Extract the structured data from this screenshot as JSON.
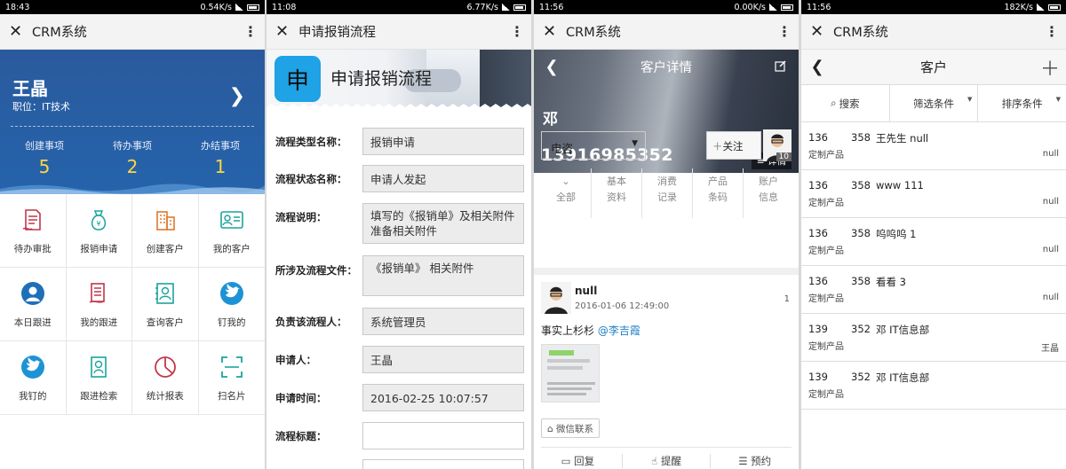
{
  "screens": [
    {
      "status": {
        "time": "18:43",
        "speed": "0.54K/s"
      },
      "title": "CRM系统",
      "user": {
        "name": "王晶",
        "position": "职位：IT技术"
      },
      "stats": [
        {
          "label": "创建事项",
          "value": "5"
        },
        {
          "label": "待办事项",
          "value": "2"
        },
        {
          "label": "办结事项",
          "value": "1"
        }
      ],
      "menu": [
        {
          "label": "待办审批",
          "icon": "document-approval-icon"
        },
        {
          "label": "报销申请",
          "icon": "money-bag-icon"
        },
        {
          "label": "创建客户",
          "icon": "building-icon"
        },
        {
          "label": "我的客户",
          "icon": "id-card-icon"
        },
        {
          "label": "本日跟进",
          "icon": "user-circle-icon"
        },
        {
          "label": "我的跟进",
          "icon": "document-list-icon"
        },
        {
          "label": "查询客户",
          "icon": "contact-card-icon"
        },
        {
          "label": "钉我的",
          "icon": "bird-icon"
        },
        {
          "label": "我钉的",
          "icon": "bird-icon"
        },
        {
          "label": "跟进检索",
          "icon": "profile-search-icon"
        },
        {
          "label": "统计报表",
          "icon": "pie-chart-icon"
        },
        {
          "label": "扫名片",
          "icon": "scan-icon"
        }
      ]
    },
    {
      "status": {
        "time": "11:08",
        "speed": "6.77K/s"
      },
      "title": "申请报销流程",
      "header": {
        "icon_char": "申",
        "title": "申请报销流程"
      },
      "fields": [
        {
          "label": "流程类型名称：",
          "value": "报销申请"
        },
        {
          "label": "流程状态名称：",
          "value": "申请人发起"
        },
        {
          "label": "流程说明：",
          "value": "填写的《报销单》及相关附件 准备相关附件"
        },
        {
          "label": "所涉及流程文件：",
          "value": "《报销单》 相关附件"
        },
        {
          "label": "负责该流程人：",
          "value": "系统管理员"
        },
        {
          "label": "申请人：",
          "value": "王晶"
        },
        {
          "label": "申请时间：",
          "value": "2016-02-25 10:07:57"
        },
        {
          "label": "流程标题：",
          "value": ""
        }
      ]
    },
    {
      "status": {
        "time": "11:56",
        "speed": "0.00K/s"
      },
      "title": "CRM系统",
      "customer": {
        "page_title": "客户详情",
        "name": "邓",
        "phone": "13916985352",
        "detail_label": "详情"
      },
      "select_value": "电咨",
      "follow_label": "关注",
      "avatar_badge": "10",
      "tabs": [
        {
          "line1": "⌄",
          "line2": "全部"
        },
        {
          "line1": "基本",
          "line2": "资料"
        },
        {
          "line1": "消费",
          "line2": "记录"
        },
        {
          "line1": "产品",
          "line2": "条码"
        },
        {
          "line1": "账户",
          "line2": "信息"
        }
      ],
      "post": {
        "author": "null",
        "time": "2016-01-06 12:49:00",
        "count": "1",
        "text": "事实上杉杉",
        "mention": "@李吉霞",
        "tag": "微信联系"
      },
      "actions": [
        "回复",
        "提醒",
        "预约"
      ]
    },
    {
      "status": {
        "time": "11:56",
        "speed": "182K/s"
      },
      "title": "CRM系统",
      "page_title": "客户",
      "filters": [
        "搜索",
        "筛选条件",
        "排序条件"
      ],
      "rows": [
        {
          "a": "136",
          "b": "358",
          "c": "王先生 null",
          "d": "定制产品",
          "e": "null"
        },
        {
          "a": "136",
          "b": "358",
          "c": "www 111",
          "d": "定制产品",
          "e": "null"
        },
        {
          "a": "136",
          "b": "358",
          "c": "呜呜呜 1",
          "d": "定制产品",
          "e": "null"
        },
        {
          "a": "136",
          "b": "358",
          "c": "看看 3",
          "d": "定制产品",
          "e": "null"
        },
        {
          "a": "139",
          "b": "352",
          "c": "邓 IT信息部",
          "d": "定制产品",
          "e": "王晶"
        },
        {
          "a": "139",
          "b": "352",
          "c": "邓 IT信息部",
          "d": "定制产品",
          "e": ""
        }
      ]
    }
  ],
  "colors": {
    "blue": "#2563ab",
    "yellow": "#ffd640",
    "red": "#c2364a",
    "teal": "#1ba39c",
    "link": "#1f7fc4"
  }
}
